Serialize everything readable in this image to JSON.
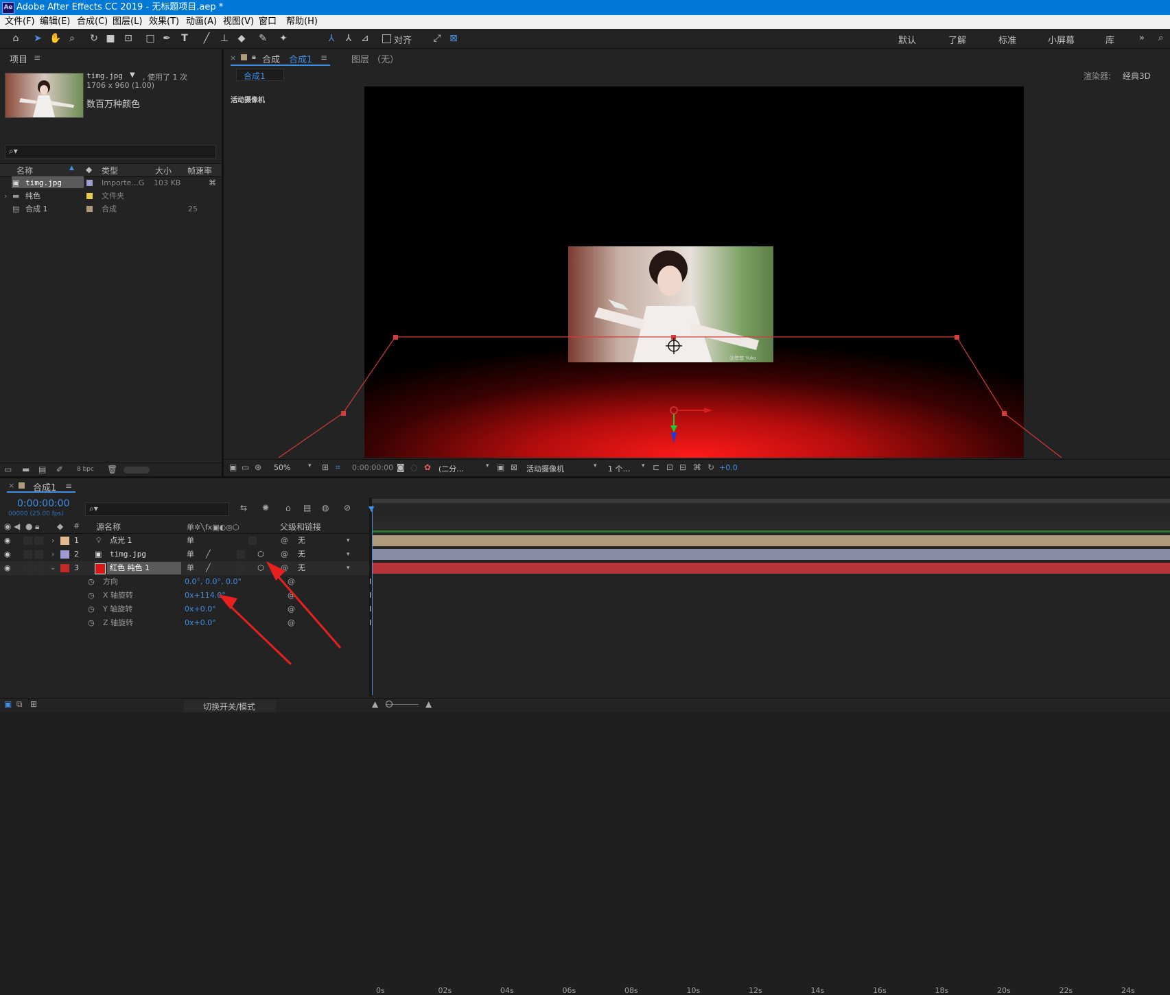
{
  "window": {
    "title": "Adobe After Effects CC 2019 - 无标题项目.aep *",
    "logo": "Ae"
  },
  "menu": [
    "文件(F)",
    "编辑(E)",
    "合成(C)",
    "图层(L)",
    "效果(T)",
    "动画(A)",
    "视图(V)",
    "窗口",
    "帮助(H)"
  ],
  "toolbar": {
    "align_label": "对齐",
    "workspaces": [
      "默认",
      "了解",
      "标准",
      "小屏幕",
      "库"
    ]
  },
  "project": {
    "tab": "项目",
    "item_name": "timg.jpg",
    "used": ", 使用了 1 次",
    "size": "1706 x 960 (1.00)",
    "colors": "数百万种颜色",
    "search_placeholder": "",
    "columns": [
      "名称",
      "类型",
      "大小",
      "帧速率"
    ],
    "rows": [
      {
        "name": "timg.jpg",
        "type": "Importe...G",
        "size": "103 KB",
        "fps": "",
        "color": "#9e9bd1"
      },
      {
        "name": "纯色",
        "type": "文件夹",
        "size": "",
        "fps": "",
        "color": "#e8cc4a"
      },
      {
        "name": "合成 1",
        "type": "合成",
        "size": "",
        "fps": "25",
        "color": "#b19a7b"
      }
    ],
    "bpc": "8 bpc"
  },
  "comp_viewer": {
    "tab_label": "合成",
    "tab_comp": "合成1",
    "layer_tab": "图层 （无）",
    "sub_tab": "合成1",
    "renderer_label": "渲染器:",
    "renderer_value": "经典3D",
    "camera_label": "活动摄像机",
    "zoom": "50%",
    "timecode": "0:00:00:00",
    "resolution": "(二分…",
    "view_camera": "活动摄像机",
    "views": "1 个…",
    "exposure": "+0.0",
    "image_watermark": "@悠悠  Yuko"
  },
  "timeline": {
    "tab": "合成1",
    "timecode": "0:00:00:00",
    "timecode_sub": "00000 (25.00 fps)",
    "col_source": "源名称",
    "col_parent": "父级和链接",
    "col_hash": "#",
    "switches_label": "切换开关/模式",
    "layers": [
      {
        "num": "1",
        "name": "点光 1",
        "color": "#e3b98f",
        "parent": "无"
      },
      {
        "num": "2",
        "name": "timg.jpg",
        "color": "#9e9bd1",
        "parent": "无"
      },
      {
        "num": "3",
        "name": "红色 纯色 1",
        "color": "#c22a2a",
        "parent": "无"
      }
    ],
    "properties": [
      {
        "name": "方向",
        "value": "0.0°, 0.0°, 0.0°"
      },
      {
        "name": "X 轴旋转",
        "value": "0x+114.0°"
      },
      {
        "name": "Y 轴旋转",
        "value": "0x+0.0°"
      },
      {
        "name": "Z 轴旋转",
        "value": "0x+0.0°"
      }
    ],
    "ruler": [
      "0s",
      "02s",
      "04s",
      "06s",
      "08s",
      "10s",
      "12s",
      "14s",
      "16s",
      "18s",
      "20s",
      "22s",
      "24s"
    ],
    "track_colors": [
      "#b09a7c",
      "#8a8ba6",
      "#b6353b"
    ]
  },
  "annotation_color": "#e8201f"
}
